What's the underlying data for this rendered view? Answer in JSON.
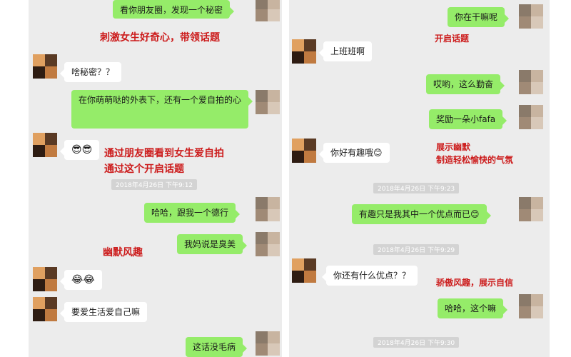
{
  "left": {
    "msg1": "看你朋友圈，发现一个秘密",
    "note1": "刺激女生好奇心，带领话题",
    "msg2": "啥秘密？？",
    "msg3": "在你萌萌哒的外表下，还有一个爱自拍的心",
    "msg4": "😎😎",
    "note2_line1": "通过朋友圈看到女生爱自拍",
    "note2_line2": "通过这个开启话题",
    "ts1": "2018年4月26日 下午9:12",
    "msg5": "哈哈，跟我一个德行",
    "msg6": "我妈说是臭美",
    "note3": "幽默风趣",
    "msg7": "😂😂",
    "msg8": "要爱生活爱自己嘛",
    "msg9": "这话没毛病"
  },
  "right": {
    "msg1": "你在干嘛呢",
    "note1": "开启话题",
    "msg2": "上班班啊",
    "msg3": "哎哟，这么勤奋",
    "msg4": "奖励一朵小fafa",
    "note2_line1": "展示幽默",
    "note2_line2": "制造轻松愉快的气氛",
    "msg5": "你好有趣哦😊",
    "ts1": "2018年4月26日 下午9:23",
    "msg6": "有趣只是我其中一个优点而已😊",
    "ts2": "2018年4月26日 下午9:29",
    "msg7": "你还有什么优点？？",
    "note3": "骄傲风趣，展示自信",
    "msg8": "哈哈，这个嘛",
    "ts3": "2018年4月26日 下午9:30"
  },
  "colors": {
    "outgoing_bubble": "#95ec69",
    "incoming_bubble": "#ffffff",
    "annotation": "#cc1b1b",
    "background": "#ececec"
  }
}
